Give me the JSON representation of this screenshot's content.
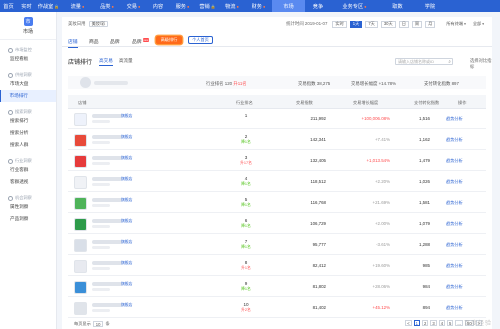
{
  "topnav": {
    "items": [
      {
        "label": "首页",
        "w": 17
      },
      {
        "label": "实时",
        "w": 19
      },
      {
        "label": "作战室",
        "w": 25,
        "lock": true
      },
      {
        "label": "流量",
        "w": 33,
        "dot": true
      },
      {
        "label": "品类",
        "w": 26,
        "dot": true
      },
      {
        "label": "交易",
        "w": 27,
        "dot": true
      },
      {
        "label": "内容",
        "w": 22
      },
      {
        "label": "服务",
        "w": 27,
        "dot": true
      },
      {
        "label": "营销",
        "w": 23,
        "lock": true
      },
      {
        "label": "物流",
        "w": 26,
        "dot": true
      },
      {
        "label": "财务",
        "w": 27,
        "dot": true
      },
      {
        "label": "市场",
        "w": 33,
        "active": true
      },
      {
        "label": "竞争",
        "w": 26
      },
      {
        "label": "业务专区",
        "w": 47,
        "dot": true
      },
      {
        "label": "取数",
        "w": 39
      },
      {
        "label": "学院",
        "w": 26
      }
    ]
  },
  "sidebar": {
    "shop_name": "市场",
    "logo_char": "市",
    "sections": [
      {
        "title": "市场监控",
        "items": [
          "监控看板"
        ]
      },
      {
        "title": "供给洞察",
        "items": [
          "市场大盘",
          "市场排行"
        ]
      },
      {
        "title": "搜索洞察",
        "items": [
          "搜索排行",
          "搜索分析",
          "搜索人群"
        ]
      },
      {
        "title": "行业洞察",
        "items": [
          "行业客群",
          "客群透视"
        ]
      },
      {
        "title": "机会洞察",
        "items": [
          "属性洞察",
          "产品洞察"
        ]
      }
    ],
    "active": "市场排行"
  },
  "toolbar": {
    "category_label": "美妆日用",
    "category_select": "美妆/彩",
    "date_label": "统计时间 2019-01-07",
    "buttons": [
      "实时",
      "1天",
      "7天",
      "30天",
      "日",
      "周",
      "月"
    ],
    "active_button": "1天",
    "source_label": "所有终端",
    "all_label": "全部"
  },
  "tabs": {
    "items": [
      {
        "label": "店铺",
        "x": 6,
        "active": true
      },
      {
        "label": "商品",
        "x": 27
      },
      {
        "label": "品牌",
        "x": 48
      },
      {
        "label": "品牌",
        "x": 70,
        "badge": "new"
      }
    ],
    "hot_label": "高级排行",
    "personal_label": "个人首页"
  },
  "ranking": {
    "title": "店铺排行",
    "subtabs": [
      "高交易",
      "高流量"
    ],
    "active_subtab": "高交易",
    "search_placeholder": "请输入店铺名称或ID",
    "custom_label": "选择对比指标"
  },
  "summary": {
    "rank_label": "行业排名 120",
    "rank_change": "升11名",
    "trade_label": "交易指数 38,275",
    "growth_label": "交易增长幅度 +14.78%",
    "conv_label": "支付转化指数 897"
  },
  "table": {
    "headers": [
      "店铺",
      "行业排名",
      "交易指数",
      "交易增长幅度",
      "支付转化指数",
      "操作"
    ],
    "rows": [
      {
        "rank": "1",
        "change": "",
        "change_color": "#52c41a",
        "trade": "211,992",
        "growth": "+100,006.08%",
        "growth_color": "#ff4d4f",
        "conv": "1,516",
        "color": "#eef2fb",
        "link": "旗舰店"
      },
      {
        "rank": "2",
        "change": "降1名",
        "change_color": "#52c41a",
        "trade": "142,341",
        "growth": "+7.41%",
        "growth_color": "#999",
        "conv": "1,162",
        "color": "#e84a3a",
        "link": "旗舰店"
      },
      {
        "rank": "3",
        "change": "升17名",
        "change_color": "#ff4d4f",
        "trade": "132,405",
        "growth": "+1,013.54%",
        "growth_color": "#ff4d4f",
        "conv": "1,479",
        "color": "#e63b3b",
        "link": "旗舰店"
      },
      {
        "rank": "4",
        "change": "降1名",
        "change_color": "#52c41a",
        "trade": "118,512",
        "growth": "+2.20%",
        "growth_color": "#999",
        "conv": "1,026",
        "color": "#f0f2f6",
        "link": "旗舰店"
      },
      {
        "rank": "5",
        "change": "降1名",
        "change_color": "#52c41a",
        "trade": "116,768",
        "growth": "+21.69%",
        "growth_color": "#999",
        "conv": "1,581",
        "color": "#4fb35a",
        "link": "旗舰店"
      },
      {
        "rank": "6",
        "change": "降1名",
        "change_color": "#52c41a",
        "trade": "106,729",
        "growth": "+2.00%",
        "growth_color": "#999",
        "conv": "1,079",
        "color": "#2e9b4a",
        "link": "旗舰店"
      },
      {
        "rank": "7",
        "change": "降1名",
        "change_color": "#52c41a",
        "trade": "95,777",
        "growth": "-3.61%",
        "growth_color": "#999",
        "conv": "1,288",
        "color": "#d9dfe8",
        "link": "旗舰店"
      },
      {
        "rank": "8",
        "change": "升1名",
        "change_color": "#ff4d4f",
        "trade": "82,412",
        "growth": "+19.60%",
        "growth_color": "#999",
        "conv": "985",
        "color": "#e8eaf0",
        "link": "旗舰店"
      },
      {
        "rank": "9",
        "change": "降1名",
        "change_color": "#52c41a",
        "trade": "81,802",
        "growth": "+28.06%",
        "growth_color": "#999",
        "conv": "984",
        "color": "#3a8fd8",
        "link": "旗舰店"
      },
      {
        "rank": "10",
        "change": "升2名",
        "change_color": "#ff4d4f",
        "trade": "81,402",
        "growth": "+45.12%",
        "growth_color": "#ff4d4f",
        "conv": "894",
        "color": "#e0e4ea",
        "link": "旗舰店"
      }
    ],
    "action_label": "趋势分析"
  },
  "pagination": {
    "page_size_label": "每页显示",
    "page_size": "10",
    "unit": "条",
    "pages": [
      "<",
      "1",
      "2",
      "3",
      "4",
      "5",
      "...",
      "50",
      ">"
    ],
    "current": "1"
  },
  "watermark": "百度经验"
}
